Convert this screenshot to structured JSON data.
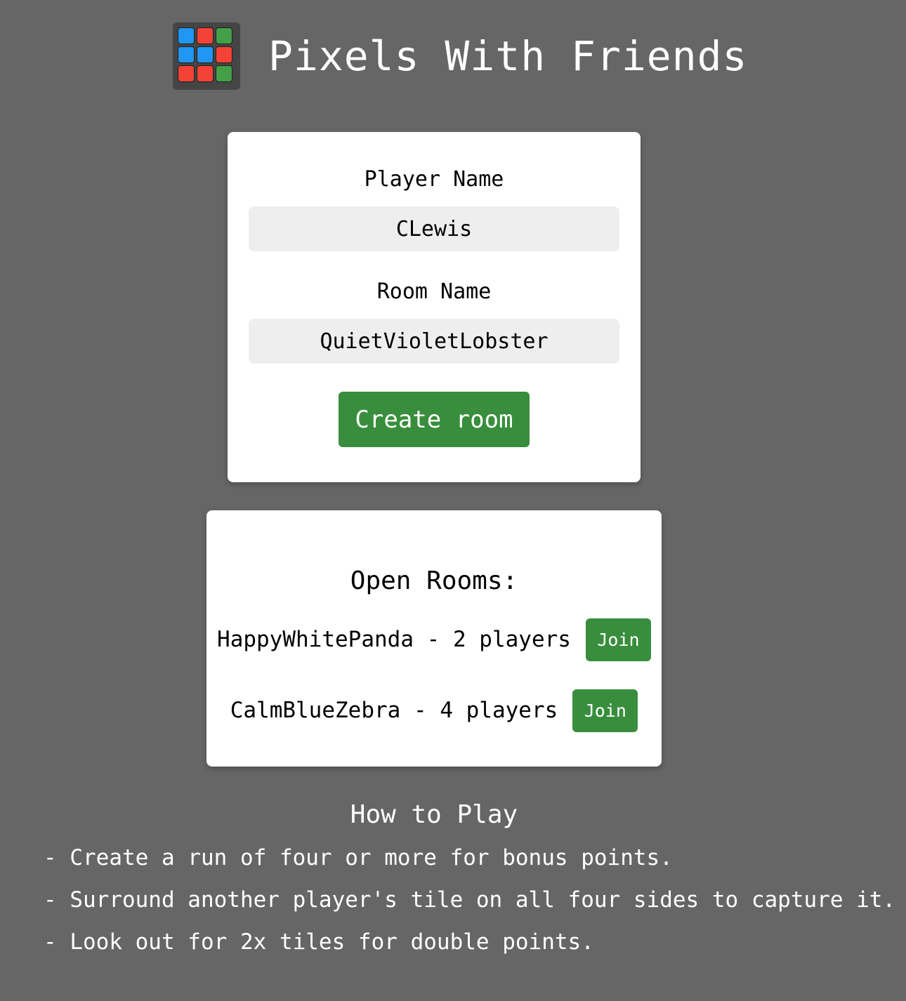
{
  "app": {
    "title": "Pixels With Friends"
  },
  "logo": {
    "icon": "pixel-grid-logo-icon",
    "tiles": [
      "#2196f3",
      "#f44336",
      "#43a047",
      "#2196f3",
      "#2196f3",
      "#f44336",
      "#f44336",
      "#f44336",
      "#43a047"
    ]
  },
  "create_form": {
    "player_label": "Player Name",
    "player_value": "CLewis",
    "room_label": "Room Name",
    "room_value": "QuietVioletLobster",
    "create_button": "Create room"
  },
  "open_rooms": {
    "heading": "Open Rooms:",
    "rooms": [
      {
        "label": "HappyWhitePanda - 2 players",
        "join": "Join"
      },
      {
        "label": "CalmBlueZebra - 4 players",
        "join": "Join"
      }
    ]
  },
  "how_to_play": {
    "title": "How to Play",
    "rules": [
      "- Create a run of four or more for bonus points.",
      "- Surround another player's tile on all four sides to capture it.",
      "- Look out for 2x tiles for double points."
    ]
  },
  "colors": {
    "background": "#666666",
    "accent": "#388e3c",
    "input_bg": "#eeeeee"
  }
}
